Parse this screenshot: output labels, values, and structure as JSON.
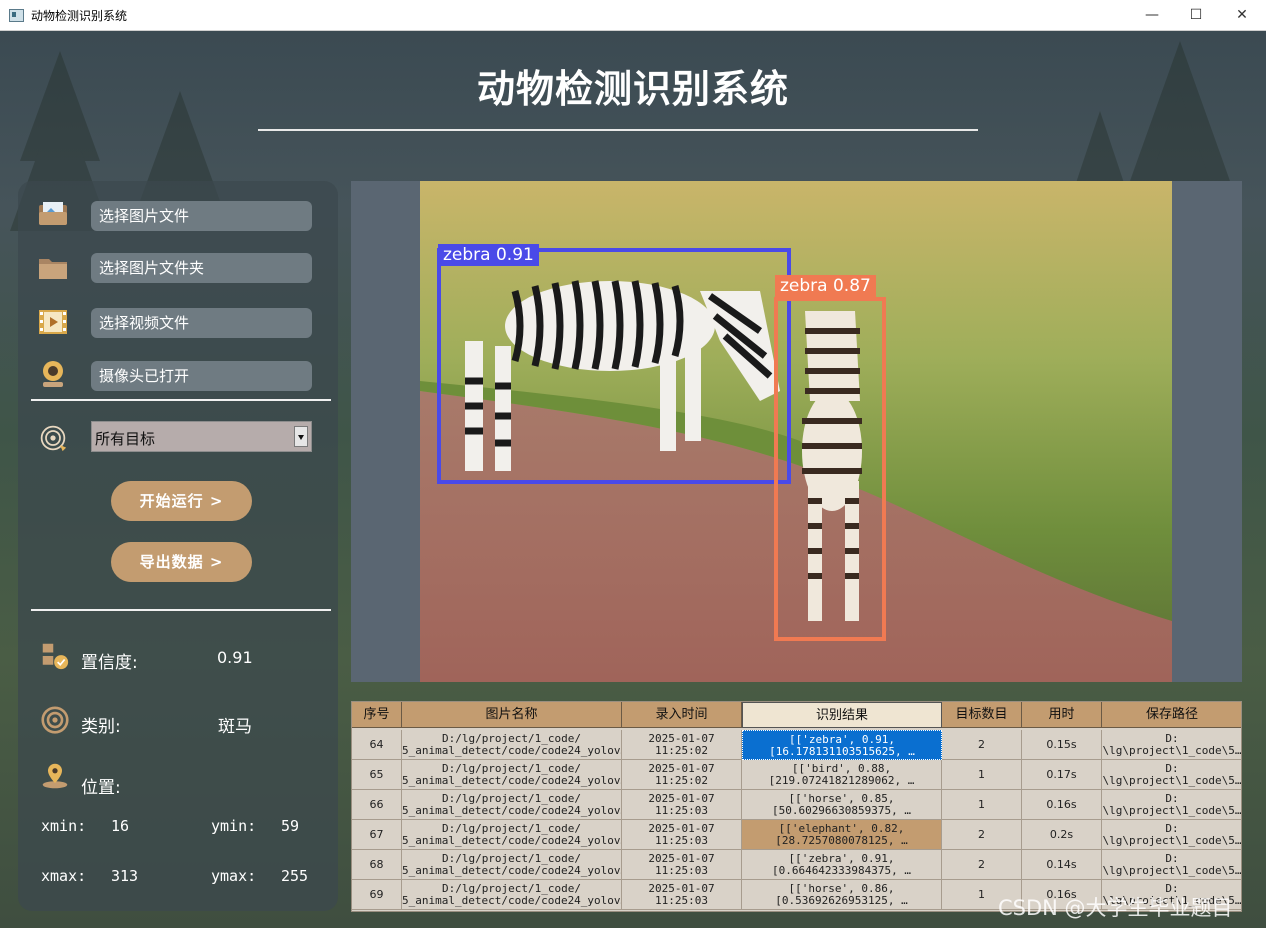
{
  "window": {
    "title": "动物检测识别系统",
    "controls": [
      "—",
      "☐",
      "✕"
    ]
  },
  "header": {
    "title": "动物检测识别系统"
  },
  "sidebar": {
    "select_image": "选择图片文件",
    "select_folder": "选择图片文件夹",
    "select_video": "选择视频文件",
    "camera": "摄像头已打开",
    "target_select": "所有目标",
    "run_button": "开始运行 >",
    "export_button": "导出数据 >",
    "confidence_label": "置信度:",
    "confidence_value": "0.91",
    "class_label": "类别:",
    "class_value": "斑马",
    "position_label": "位置:",
    "xmin_label": "xmin:",
    "xmin_value": "16",
    "ymin_label": "ymin:",
    "ymin_value": "59",
    "xmax_label": "xmax:",
    "xmax_value": "313",
    "ymax_label": "ymax:",
    "ymax_value": "255"
  },
  "detections": [
    {
      "label": "zebra 0.91",
      "color": "#4a4ae8"
    },
    {
      "label": "zebra 0.87",
      "color": "#f07a52"
    }
  ],
  "table": {
    "headers": [
      "序号",
      "图片名称",
      "录入时间",
      "识别结果",
      "目标数目",
      "用时",
      "保存路径"
    ],
    "rows": [
      {
        "id": "64",
        "name": "D:/lg/project/1_code/\n5_animal_detect/code/code24_yolov…",
        "time": "2025-01-07\n11:25:02",
        "result": "[['zebra', 0.91,\n[16.178131103515625, …",
        "count": "2",
        "duration": "0.15s",
        "path": "D:\n\\lg\\project\\1_code\\5…"
      },
      {
        "id": "65",
        "name": "D:/lg/project/1_code/\n5_animal_detect/code/code24_yolov…",
        "time": "2025-01-07\n11:25:02",
        "result": "[['bird', 0.88,\n[219.07241821289062, …",
        "count": "1",
        "duration": "0.17s",
        "path": "D:\n\\lg\\project\\1_code\\5…"
      },
      {
        "id": "66",
        "name": "D:/lg/project/1_code/\n5_animal_detect/code/code24_yolov…",
        "time": "2025-01-07\n11:25:03",
        "result": "[['horse', 0.85,\n[50.60296630859375, …",
        "count": "1",
        "duration": "0.16s",
        "path": "D:\n\\lg\\project\\1_code\\5…"
      },
      {
        "id": "67",
        "name": "D:/lg/project/1_code/\n5_animal_detect/code/code24_yolov…",
        "time": "2025-01-07\n11:25:03",
        "result": "[['elephant', 0.82,\n[28.7257080078125, …",
        "count": "2",
        "duration": "0.2s",
        "path": "D:\n\\lg\\project\\1_code\\5…"
      },
      {
        "id": "68",
        "name": "D:/lg/project/1_code/\n5_animal_detect/code/code24_yolov…",
        "time": "2025-01-07\n11:25:03",
        "result": "[['zebra', 0.91,\n[0.664642333984375, …",
        "count": "2",
        "duration": "0.14s",
        "path": "D:\n\\lg\\project\\1_code\\5…"
      },
      {
        "id": "69",
        "name": "D:/lg/project/1_code/\n5_animal_detect/code/code24_yolov…",
        "time": "2025-01-07\n11:25:03",
        "result": "[['horse', 0.86,\n[0.53692626953125, …",
        "count": "1",
        "duration": "0.16s",
        "path": "D:\n\\lg\\project\\1_code\\5…"
      }
    ]
  },
  "watermark": "CSDN @大学生毕业题目"
}
